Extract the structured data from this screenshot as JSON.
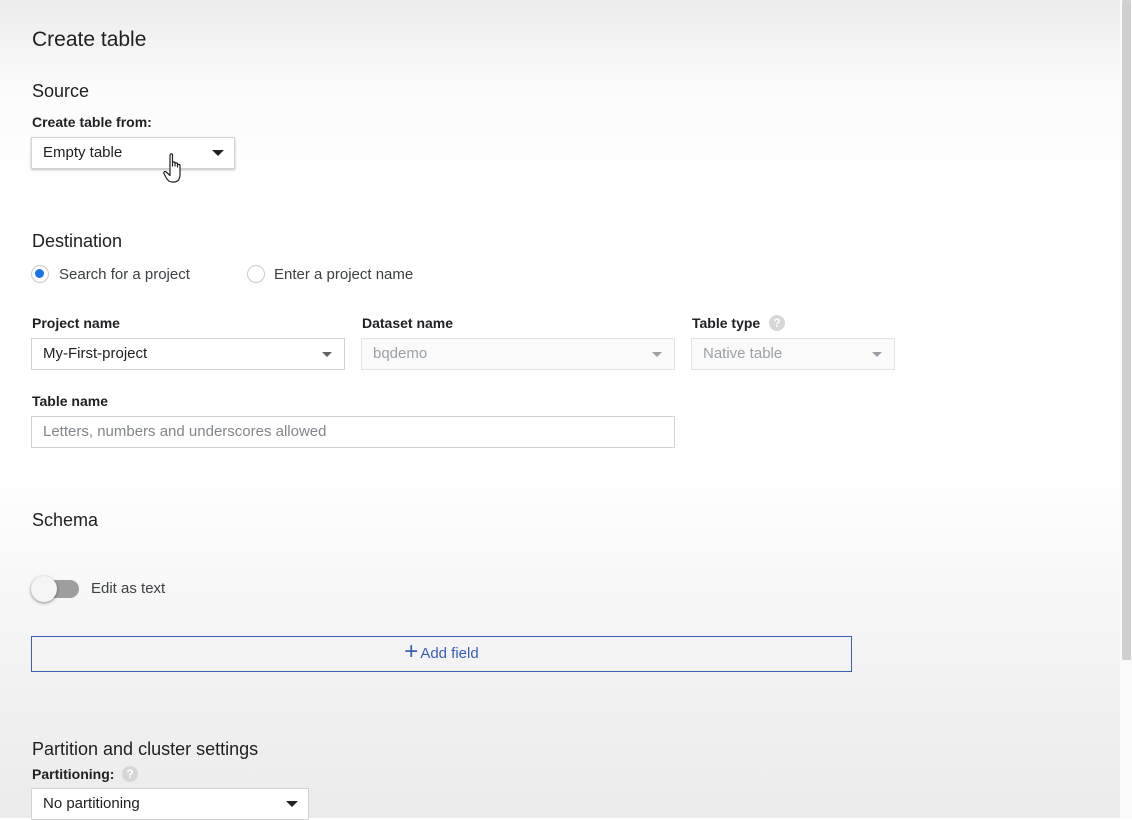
{
  "page": {
    "title": "Create table"
  },
  "source": {
    "heading": "Source",
    "create_from_label": "Create table from:",
    "create_from_value": "Empty table"
  },
  "destination": {
    "heading": "Destination",
    "radio_search": "Search for a project",
    "radio_enter": "Enter a project name",
    "project_name_label": "Project name",
    "project_name_value": "My-First-project",
    "dataset_name_label": "Dataset name",
    "dataset_name_value": "bqdemo",
    "table_type_label": "Table type",
    "table_type_value": "Native table",
    "table_name_label": "Table name",
    "table_name_placeholder": "Letters, numbers and underscores allowed"
  },
  "schema": {
    "heading": "Schema",
    "edit_as_text_label": "Edit as text",
    "add_field_plus": "+",
    "add_field_label": "Add field"
  },
  "partition": {
    "heading": "Partition and cluster settings",
    "partitioning_label": "Partitioning:",
    "partitioning_value": "No partitioning"
  },
  "icons": {
    "help": "help-icon",
    "dropdown": "chevron-down-icon",
    "cursor": "hand-pointer-icon"
  },
  "colors": {
    "accent": "#1a73e8",
    "button_outline": "#3b5fb0"
  }
}
